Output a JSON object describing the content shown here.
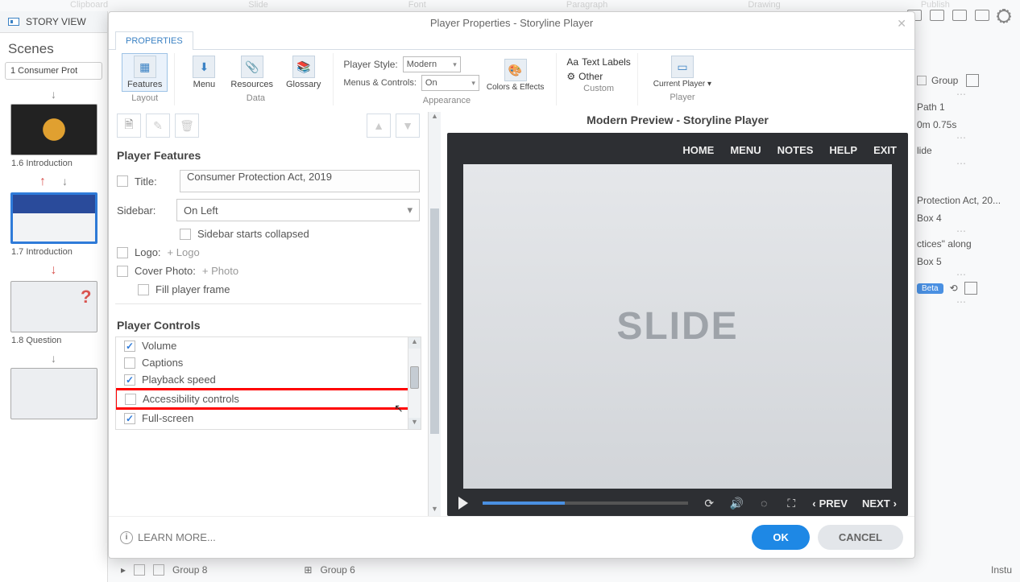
{
  "ribbon_top": [
    "Clipboard",
    "Slide",
    "Font",
    "Paragraph",
    "Publish",
    "Drawing"
  ],
  "story_view_label": "STORY VIEW",
  "scenes_title": "Scenes",
  "scene_item": "1 Consumer Prot",
  "thumbs": [
    {
      "label": "1.6 Introduction"
    },
    {
      "label": "1.7 Introduction"
    },
    {
      "label": "1.8 Question"
    }
  ],
  "icon_row_group_label": "Group",
  "right_items": [
    "Path 1",
    "0m 0.75s",
    "lide",
    "Protection Act, 20...",
    "Box 4",
    "ctices\" along",
    "Box 5"
  ],
  "beta_label": "Beta",
  "dialog": {
    "title": "Player Properties - Storyline Player",
    "tab": "PROPERTIES",
    "ribbon": {
      "layout": {
        "features": "Features",
        "group": "Layout"
      },
      "data": {
        "menu": "Menu",
        "resources": "Resources",
        "glossary": "Glossary",
        "group": "Data"
      },
      "appearance": {
        "player_style_label": "Player Style:",
        "player_style_value": "Modern",
        "menus_label": "Menus & Controls:",
        "menus_value": "On",
        "colors": "Colors & Effects",
        "group": "Appearance"
      },
      "custom": {
        "text_labels": "Text Labels",
        "other": "Other",
        "group": "Custom"
      },
      "player": {
        "current": "Current Player",
        "group": "Player"
      }
    },
    "features": {
      "section": "Player Features",
      "title_label": "Title:",
      "title_value": "Consumer Protection Act, 2019",
      "sidebar_label": "Sidebar:",
      "sidebar_value": "On Left",
      "sidebar_collapse": "Sidebar starts collapsed",
      "logo_label": "Logo:",
      "logo_link": "+ Logo",
      "cover_label": "Cover Photo:",
      "cover_link": "+ Photo",
      "fill_frame": "Fill player frame"
    },
    "controls": {
      "section": "Player Controls",
      "items": [
        {
          "label": "Volume",
          "checked": true
        },
        {
          "label": "Captions",
          "checked": false
        },
        {
          "label": "Playback speed",
          "checked": true
        },
        {
          "label": "Accessibility controls",
          "checked": false,
          "highlight": true
        },
        {
          "label": "Full-screen",
          "checked": true
        }
      ]
    },
    "preview": {
      "title": "Modern Preview - Storyline Player",
      "nav": [
        "HOME",
        "MENU",
        "NOTES",
        "HELP",
        "EXIT"
      ],
      "slide_text": "SLIDE",
      "prev": "PREV",
      "next": "NEXT"
    },
    "learn_more": "LEARN MORE...",
    "ok": "OK",
    "cancel": "CANCEL"
  },
  "bottom": {
    "group_a": "Group 8",
    "group_b": "Group 6",
    "instu": "Instu"
  }
}
